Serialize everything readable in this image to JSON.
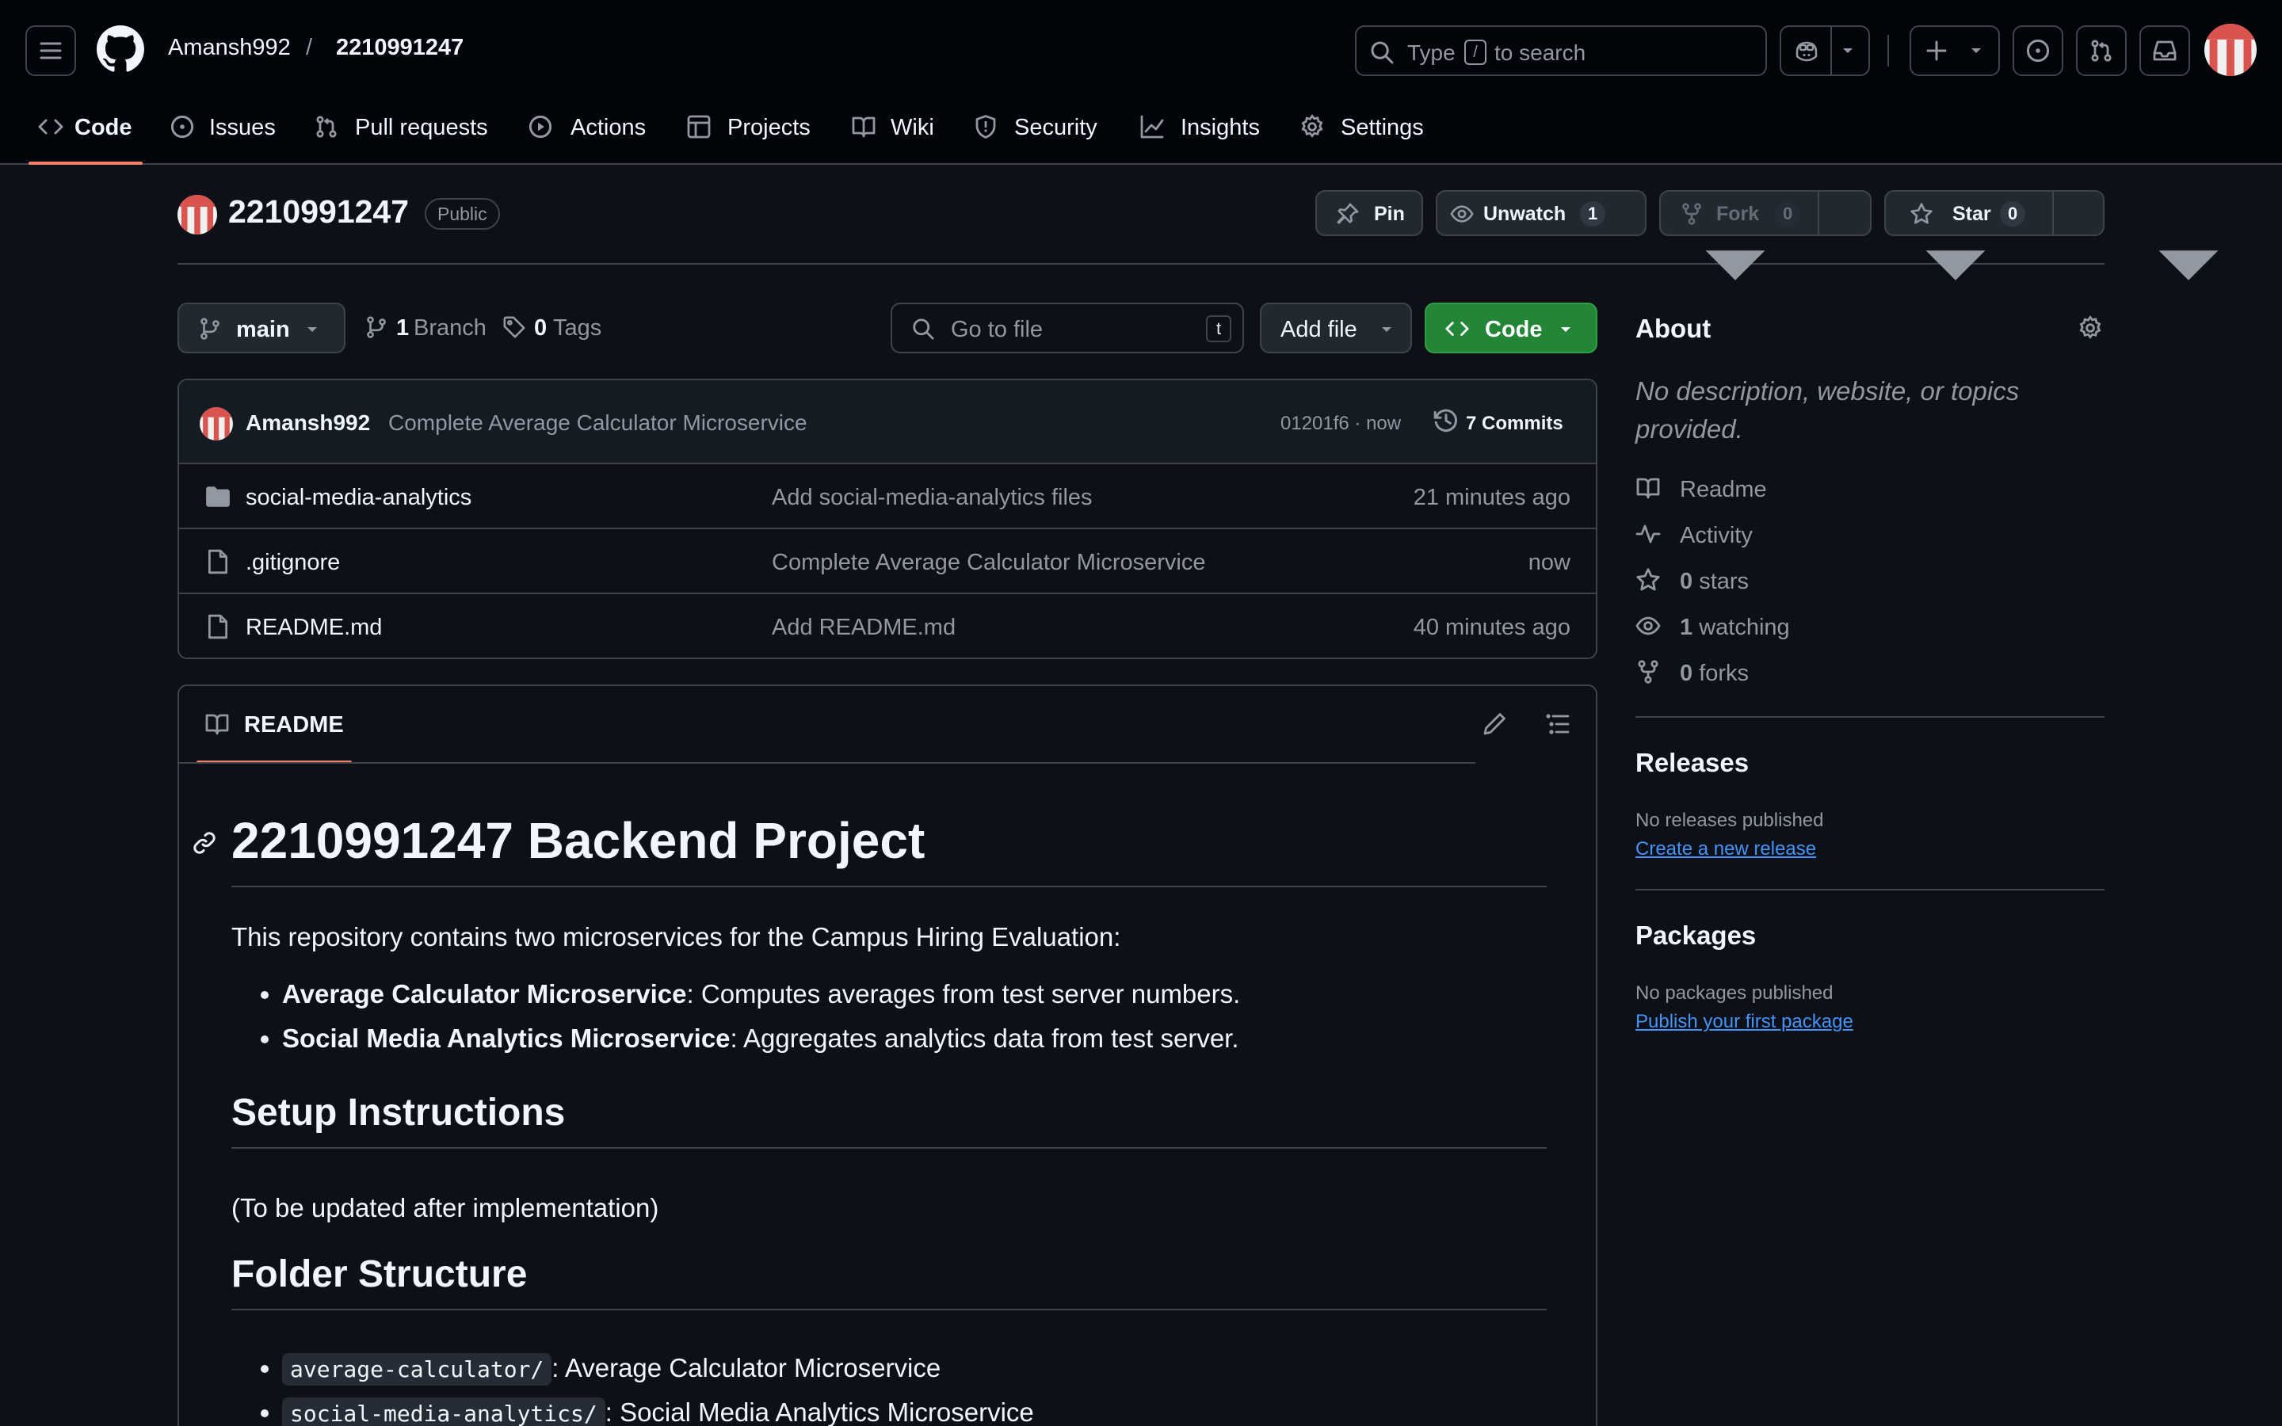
{
  "header": {
    "owner": "Amansh992",
    "separator": "/",
    "repo": "2210991247",
    "search_prefix": "Type",
    "search_key": "/",
    "search_suffix": "to search"
  },
  "nav": {
    "tabs": [
      {
        "label": "Code",
        "icon": "code-icon",
        "active": true
      },
      {
        "label": "Issues",
        "icon": "issue-icon"
      },
      {
        "label": "Pull requests",
        "icon": "pull-request-icon"
      },
      {
        "label": "Actions",
        "icon": "play-icon"
      },
      {
        "label": "Projects",
        "icon": "table-icon"
      },
      {
        "label": "Wiki",
        "icon": "book-icon"
      },
      {
        "label": "Security",
        "icon": "shield-icon"
      },
      {
        "label": "Insights",
        "icon": "graph-icon"
      },
      {
        "label": "Settings",
        "icon": "gear-icon"
      }
    ]
  },
  "repo_header": {
    "name": "2210991247",
    "visibility": "Public",
    "pin_label": "Pin",
    "unwatch_label": "Unwatch",
    "watch_count": "1",
    "fork_label": "Fork",
    "fork_count": "0",
    "star_label": "Star",
    "star_count": "0"
  },
  "file_nav": {
    "branch": "main",
    "branch_count": "1",
    "branch_label": "Branch",
    "tag_count": "0",
    "tag_label": "Tags",
    "goto_placeholder": "Go to file",
    "goto_key": "t",
    "add_file_label": "Add file",
    "code_label": "Code"
  },
  "latest_commit": {
    "author": "Amansh992",
    "message": "Complete Average Calculator Microservice",
    "sha_time": "01201f6 · now",
    "commits_label": "7 Commits"
  },
  "files": [
    {
      "name": "social-media-analytics",
      "type": "folder",
      "message": "Add social-media-analytics files",
      "time": "21 minutes ago"
    },
    {
      "name": ".gitignore",
      "type": "file",
      "message": "Complete Average Calculator Microservice",
      "time": "now"
    },
    {
      "name": "README.md",
      "type": "file",
      "message": "Add README.md",
      "time": "40 minutes ago"
    }
  ],
  "readme": {
    "tab_label": "README",
    "title": "2210991247 Backend Project",
    "intro": "This repository contains two microservices for the Campus Hiring Evaluation:",
    "services": [
      {
        "name": "Average Calculator Microservice",
        "desc": ": Computes averages from test server numbers."
      },
      {
        "name": "Social Media Analytics Microservice",
        "desc": ": Aggregates analytics data from test server."
      }
    ],
    "setup_heading": "Setup Instructions",
    "setup_text": "(To be updated after implementation)",
    "folder_heading": "Folder Structure",
    "folders": [
      {
        "path": "average-calculator/",
        "desc": ": Average Calculator Microservice"
      },
      {
        "path": "social-media-analytics/",
        "desc": ": Social Media Analytics Microservice"
      }
    ]
  },
  "about": {
    "title": "About",
    "description": "No description, website, or topics provided.",
    "readme_label": "Readme",
    "activity_label": "Activity",
    "stars_count": "0",
    "stars_label": "stars",
    "watching_count": "1",
    "watching_label": "watching",
    "forks_count": "0",
    "forks_label": "forks",
    "releases_title": "Releases",
    "releases_text": "No releases published",
    "releases_link": "Create a new release",
    "packages_title": "Packages",
    "packages_text": "No packages published",
    "packages_link": "Publish your first package"
  },
  "colors": {
    "accent_tab": "#f78166",
    "green_button": "#238636",
    "link": "#4493f8",
    "avatar_red": "#d9534f"
  }
}
